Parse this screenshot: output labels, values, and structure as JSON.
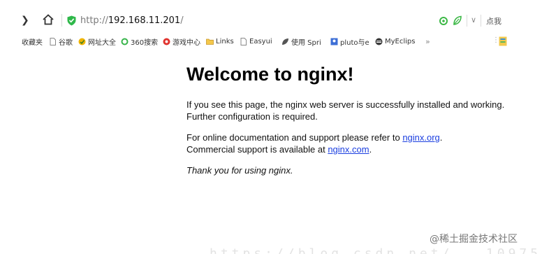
{
  "address_bar": {
    "forward_glyph": "❯",
    "url_scheme": "http://",
    "url_host": "192.168.11.201",
    "url_rest": "/",
    "right_text": "点我"
  },
  "bookmarks": {
    "items": [
      {
        "label": "收藏夹",
        "icon": "star-icon"
      },
      {
        "label": "谷歌",
        "icon": "page-icon"
      },
      {
        "label": "网址大全",
        "icon": "globe-icon"
      },
      {
        "label": "360搜索",
        "icon": "circle-icon"
      },
      {
        "label": "游戏中心",
        "icon": "game-icon"
      },
      {
        "label": "Links",
        "icon": "folder-icon"
      },
      {
        "label": "Easyui",
        "icon": "page-icon"
      },
      {
        "label": "使用 Spri",
        "icon": "leaf-icon"
      },
      {
        "label": "pluto与e",
        "icon": "image-icon"
      },
      {
        "label": "MyEclips",
        "icon": "eclipse-icon"
      }
    ],
    "more": "»",
    "end_glyph": "⋮"
  },
  "page": {
    "title": "Welcome to nginx!",
    "p1": "If you see this page, the nginx web server is successfully installed and working. Further configuration is required.",
    "p2_prefix": "For online documentation and support please refer to ",
    "p2_link1": "nginx.org",
    "p2_mid": ".",
    "p2_line2": "Commercial support is available at ",
    "p2_link2": "nginx.com",
    "p2_end": ".",
    "p3": "Thank you for using nginx."
  },
  "watermark": {
    "text": "@稀土掘金技术社区",
    "faint_url": "https://blog.csdn.net/...1097597"
  },
  "colors": {
    "link": "#1a3ee0",
    "shield": "#2fb84a",
    "text": "#111111"
  }
}
